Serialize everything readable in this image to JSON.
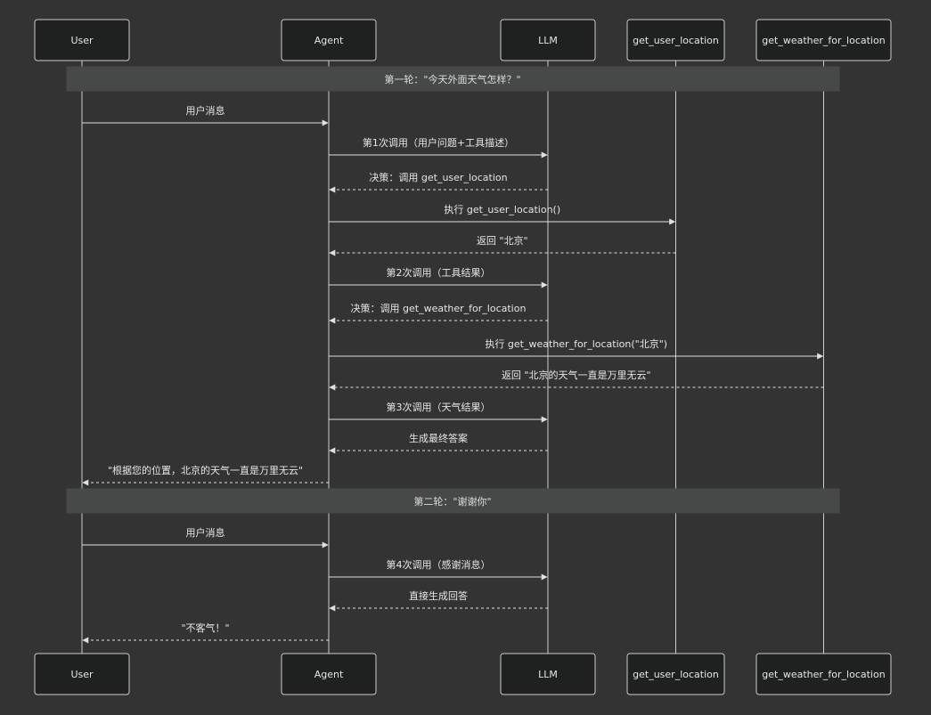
{
  "participants": [
    {
      "id": "user",
      "label": "User"
    },
    {
      "id": "agent",
      "label": "Agent"
    },
    {
      "id": "llm",
      "label": "LLM"
    },
    {
      "id": "get_user_location",
      "label": "get_user_location"
    },
    {
      "id": "get_weather_for_location",
      "label": "get_weather_for_location"
    }
  ],
  "sections": [
    {
      "label": "第一轮：\"今天外面天气怎样？\""
    },
    {
      "label": "第二轮：\"谢谢你\""
    }
  ],
  "messages": [
    {
      "from": "user",
      "to": "agent",
      "style": "solid",
      "label": "用户消息"
    },
    {
      "from": "agent",
      "to": "llm",
      "style": "solid",
      "label": "第1次调用（用户问题+工具描述）"
    },
    {
      "from": "llm",
      "to": "agent",
      "style": "dashed",
      "label": "决策：调用 get_user_location"
    },
    {
      "from": "agent",
      "to": "get_user_location",
      "style": "solid",
      "label": "执行 get_user_location()"
    },
    {
      "from": "get_user_location",
      "to": "agent",
      "style": "dashed",
      "label": "返回 \"北京\""
    },
    {
      "from": "agent",
      "to": "llm",
      "style": "solid",
      "label": "第2次调用（工具结果）"
    },
    {
      "from": "llm",
      "to": "agent",
      "style": "dashed",
      "label": "决策：调用 get_weather_for_location"
    },
    {
      "from": "agent",
      "to": "get_weather_for_location",
      "style": "solid",
      "label": "执行 get_weather_for_location(\"北京\")"
    },
    {
      "from": "get_weather_for_location",
      "to": "agent",
      "style": "dashed",
      "label": "返回 \"北京的天气一直是万里无云\""
    },
    {
      "from": "agent",
      "to": "llm",
      "style": "solid",
      "label": "第3次调用（天气结果）"
    },
    {
      "from": "llm",
      "to": "agent",
      "style": "dashed",
      "label": "生成最终答案"
    },
    {
      "from": "agent",
      "to": "user",
      "style": "dashed",
      "label": "\"根据您的位置，北京的天气一直是万里无云\""
    },
    {
      "from": "user",
      "to": "agent",
      "style": "solid",
      "label": "用户消息"
    },
    {
      "from": "agent",
      "to": "llm",
      "style": "solid",
      "label": "第4次调用（感谢消息）"
    },
    {
      "from": "llm",
      "to": "agent",
      "style": "dashed",
      "label": "直接生成回答"
    },
    {
      "from": "agent",
      "to": "user",
      "style": "dashed",
      "label": "\"不客气！\""
    }
  ]
}
